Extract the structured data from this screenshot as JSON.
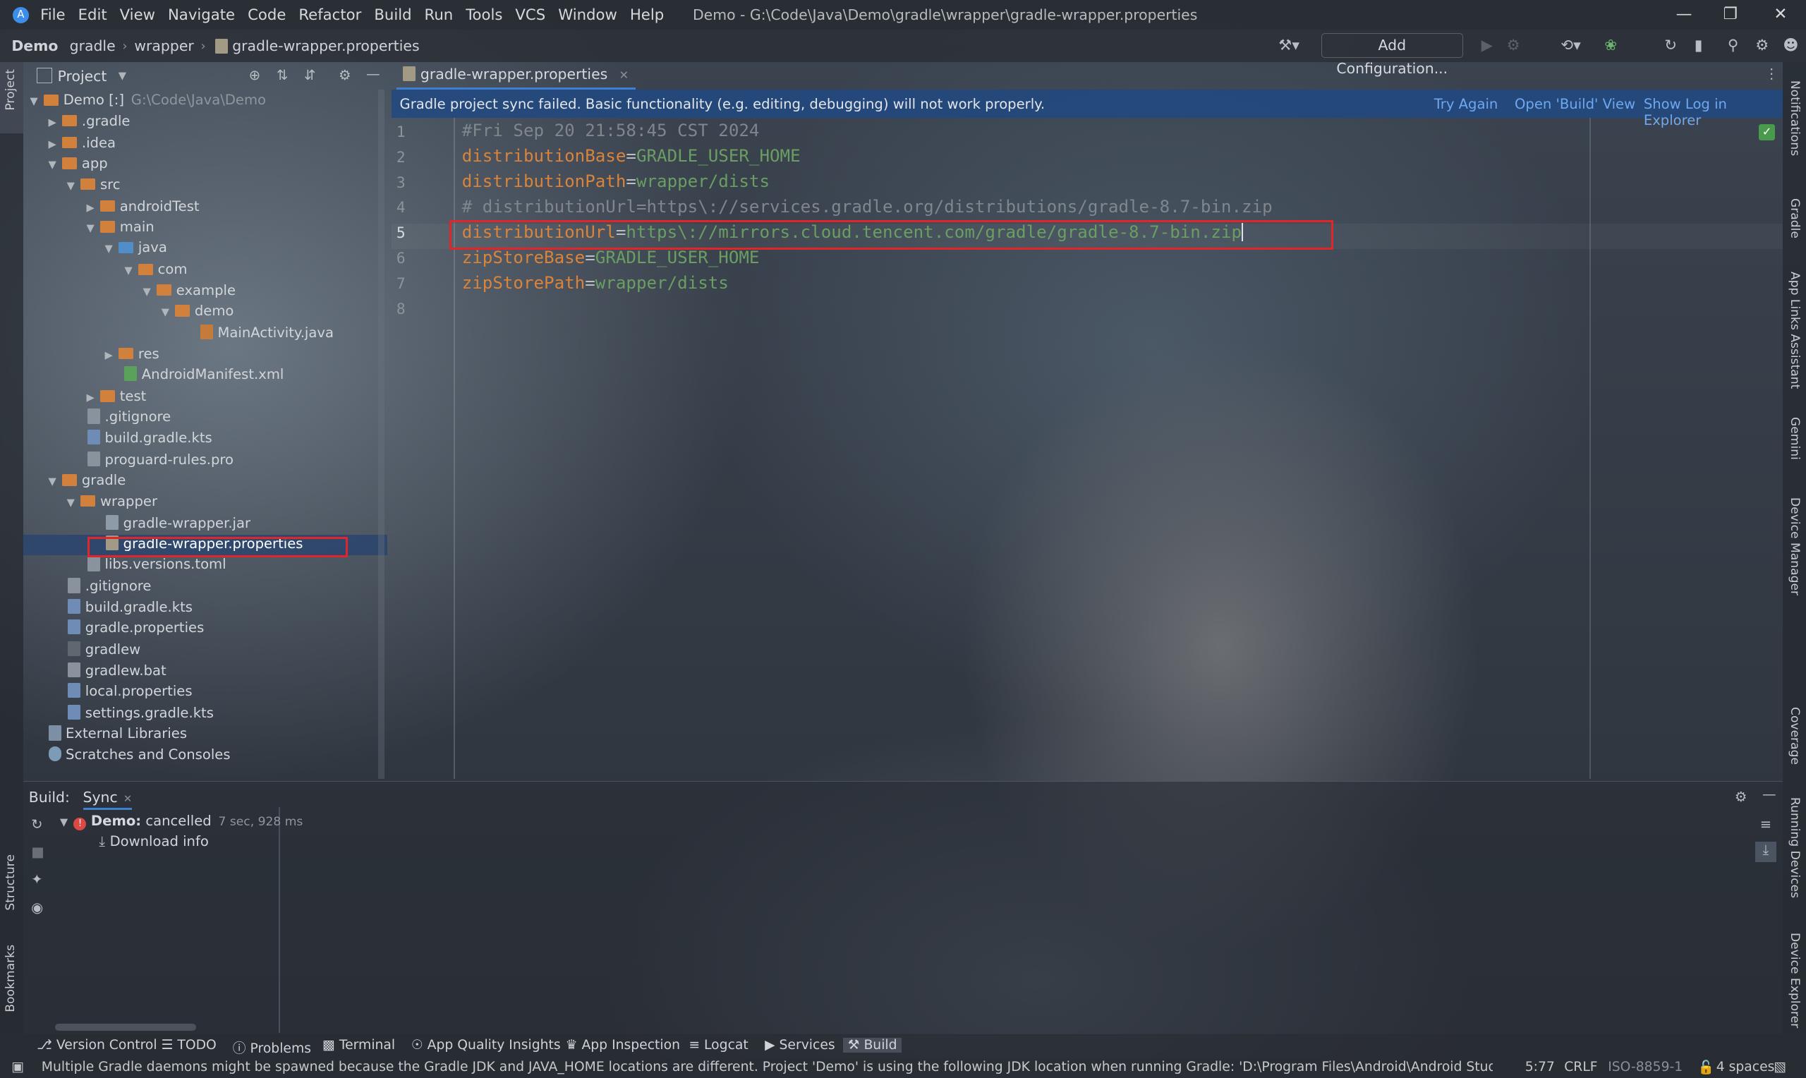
{
  "titlebar": {
    "menus": [
      "File",
      "Edit",
      "View",
      "Navigate",
      "Code",
      "Refactor",
      "Build",
      "Run",
      "Tools",
      "VCS",
      "Window",
      "Help"
    ],
    "window_title": "Demo - G:\\Code\\Java\\Demo\\gradle\\wrapper\\gradle-wrapper.properties"
  },
  "navbar": {
    "breadcrumbs": [
      "Demo",
      "gradle",
      "wrapper",
      "gradle-wrapper.properties"
    ],
    "add_configuration": "Add Configuration..."
  },
  "left_stripe": {
    "project": "Project",
    "structure": "Structure",
    "bookmarks": "Bookmarks"
  },
  "right_stripe": {
    "notifications": "Notifications",
    "gradle": "Gradle",
    "app_links": "App Links Assistant",
    "gemini": "Gemini",
    "device_manager": "Device Manager",
    "coverage": "Coverage",
    "running_devices": "Running Devices",
    "device_explorer": "Device Explorer"
  },
  "project_panel": {
    "title": "Project",
    "tree": [
      {
        "label": "Demo [:]",
        "extra": "G:\\Code\\Java\\Demo"
      },
      {
        "label": ".gradle"
      },
      {
        "label": ".idea"
      },
      {
        "label": "app"
      },
      {
        "label": "src"
      },
      {
        "label": "androidTest"
      },
      {
        "label": "main"
      },
      {
        "label": "java"
      },
      {
        "label": "com"
      },
      {
        "label": "example"
      },
      {
        "label": "demo"
      },
      {
        "label": "MainActivity.java"
      },
      {
        "label": "res"
      },
      {
        "label": "AndroidManifest.xml"
      },
      {
        "label": "test"
      },
      {
        "label": ".gitignore"
      },
      {
        "label": "build.gradle.kts"
      },
      {
        "label": "proguard-rules.pro"
      },
      {
        "label": "gradle"
      },
      {
        "label": "wrapper"
      },
      {
        "label": "gradle-wrapper.jar"
      },
      {
        "label": "gradle-wrapper.properties"
      },
      {
        "label": "libs.versions.toml"
      },
      {
        "label": ".gitignore"
      },
      {
        "label": "build.gradle.kts"
      },
      {
        "label": "gradle.properties"
      },
      {
        "label": "gradlew"
      },
      {
        "label": "gradlew.bat"
      },
      {
        "label": "local.properties"
      },
      {
        "label": "settings.gradle.kts"
      },
      {
        "label": "External Libraries"
      },
      {
        "label": "Scratches and Consoles"
      }
    ]
  },
  "editor": {
    "tab_label": "gradle-wrapper.properties",
    "banner": {
      "message": "Gradle project sync failed. Basic functionality (e.g. editing, debugging) will not work properly.",
      "try_again": "Try Again",
      "open_build": "Open 'Build' View",
      "show_log": "Show Log in Explorer"
    },
    "lines": [
      {
        "n": "1",
        "comment": "#Fri Sep 20 21:58:45 CST 2024"
      },
      {
        "n": "2",
        "key": "distributionBase",
        "eq": "=",
        "val": "GRADLE_USER_HOME"
      },
      {
        "n": "3",
        "key": "distributionPath",
        "eq": "=",
        "val": "wrapper/dists"
      },
      {
        "n": "4",
        "comment": "# distributionUrl=https\\://services.gradle.org/distributions/gradle-8.7-bin.zip"
      },
      {
        "n": "5",
        "key": "distributionUrl",
        "eq": "=",
        "val": "https\\://mirrors.cloud.tencent.com/gradle/gradle-8.7-bin.zip"
      },
      {
        "n": "6",
        "key": "zipStoreBase",
        "eq": "=",
        "val": "GRADLE_USER_HOME"
      },
      {
        "n": "7",
        "key": "zipStorePath",
        "eq": "=",
        "val": "wrapper/dists"
      },
      {
        "n": "8"
      }
    ]
  },
  "build_panel": {
    "label": "Build:",
    "tab": "Sync",
    "root_label": "Demo:",
    "root_status": "cancelled",
    "root_time": "7 sec, 928 ms",
    "child": "Download info"
  },
  "tool_windows": [
    "Version Control",
    "TODO",
    "Problems",
    "Terminal",
    "App Quality Insights",
    "App Inspection",
    "Logcat",
    "Services",
    "Build"
  ],
  "statusbar": {
    "message": "Multiple Gradle daemons might be spawned because the Gradle JDK and JAVA_HOME locations are different. Project 'Demo' is using the following JDK location when running Gradle: 'D:\\Program Files\\Android\\Android Studio... (a minute ag",
    "position": "5:77",
    "line_sep": "CRLF",
    "encoding": "ISO-8859-1",
    "indent": "4 spaces"
  }
}
